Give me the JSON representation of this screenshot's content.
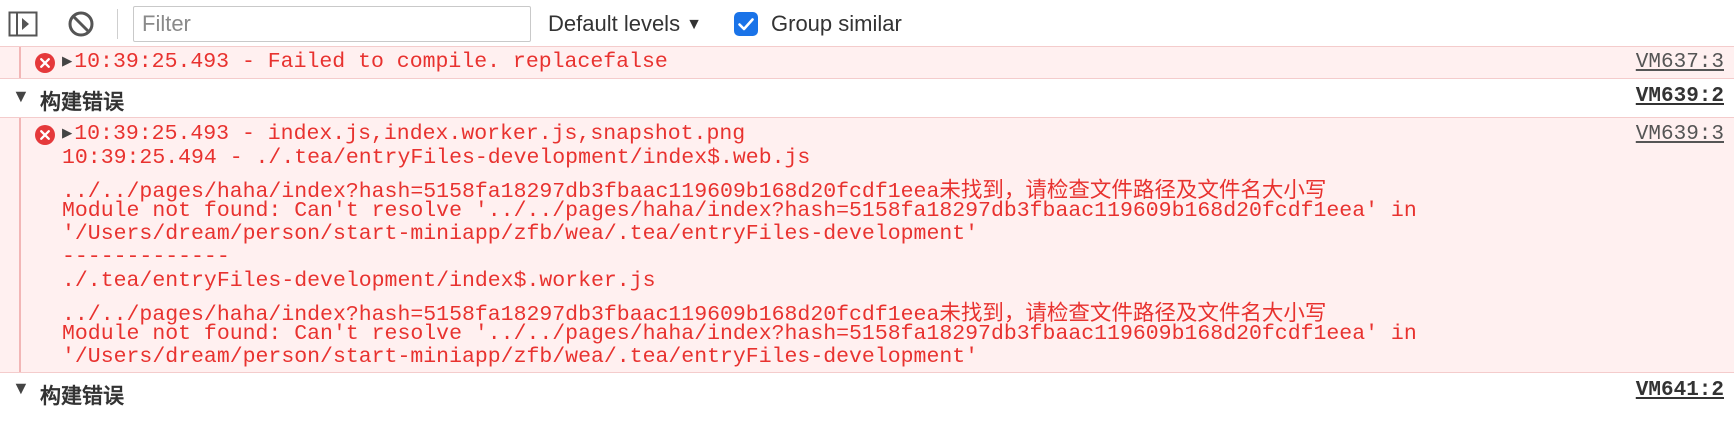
{
  "toolbar": {
    "sidebar_icon": "sidebar-toggle-icon",
    "clear_icon": "clear-console-icon",
    "filter_placeholder": "Filter",
    "filter_value": "",
    "levels_label": "Default levels",
    "levels_caret": "▼",
    "group_similar_label": "Group similar",
    "group_similar_checked": true,
    "accent_color": "#1a73e8"
  },
  "colors": {
    "error_text": "#e8322f",
    "error_bg": "#fff0f0"
  },
  "messages": {
    "msg1": {
      "icon": "error-icon",
      "text": "10:39:25.493 - Failed to compile. replacefalse",
      "source": "VM637:3"
    },
    "group1": {
      "title": "构建错误",
      "source": "VM639:2"
    },
    "msg2": {
      "icon": "error-icon",
      "source": "VM639:3",
      "lines": [
        "10:39:25.493 - index.js,index.worker.js,snapshot.png",
        "10:39:25.494 - ./.tea/entryFiles-development/index$.web.js",
        "../../pages/haha/index?hash=5158fa18297db3fbaac119609b168d20fcdf1eea未找到，请检查文件路径及文件名大小写",
        "Module not found: Can't resolve '../../pages/haha/index?hash=5158fa18297db3fbaac119609b168d20fcdf1eea' in",
        "'/Users/dream/person/start-miniapp/zfb/wea/.tea/entryFiles-development'",
        "-------------",
        "./.tea/entryFiles-development/index$.worker.js",
        "../../pages/haha/index?hash=5158fa18297db3fbaac119609b168d20fcdf1eea未找到，请检查文件路径及文件名大小写",
        "Module not found: Can't resolve '../../pages/haha/index?hash=5158fa18297db3fbaac119609b168d20fcdf1eea' in",
        "'/Users/dream/person/start-miniapp/zfb/wea/.tea/entryFiles-development'"
      ]
    },
    "group2": {
      "title": "构建错误",
      "source": "VM641:2"
    }
  }
}
